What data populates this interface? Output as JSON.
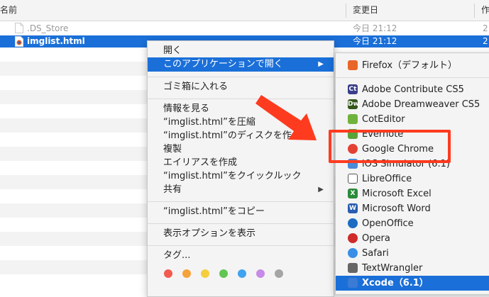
{
  "finder": {
    "columns": {
      "name": "名前",
      "date": "変更日",
      "kind": "作"
    },
    "files": [
      {
        "name": ".DS_Store",
        "date": "今日 21:12",
        "kind": "2",
        "state": "dim"
      },
      {
        "name": "imglist.html",
        "date": "今日 21:12",
        "kind": "2",
        "state": "selected"
      }
    ]
  },
  "context_menu": {
    "open": "開く",
    "open_with": "このアプリケーションで開く",
    "trash": "ゴミ箱に入れる",
    "get_info": "情報を見る",
    "compress": "“imglist.html”を圧縮",
    "burn": "“imglist.html”のディスクを作",
    "duplicate": "複製",
    "make_alias": "エイリアスを作成",
    "quick_look": "“imglist.html”をクイックルック",
    "share": "共有",
    "copy": "“imglist.html”をコピー",
    "view_options": "表示オプションを表示",
    "tags": "タグ...",
    "tag_colors": [
      "#f25b4f",
      "#f6a33b",
      "#f4cf3d",
      "#61c554",
      "#3fa3f0",
      "#c78ae8",
      "#a5a5a5"
    ]
  },
  "open_with_submenu": {
    "items": [
      {
        "label": "Firefox（デフォルト）",
        "icon": "firefox-icon",
        "color": "#e8662a"
      },
      {
        "label": "Adobe Contribute CS5",
        "icon": "contribute-icon",
        "color": "#3a3e8c",
        "glyph": "Ct"
      },
      {
        "label": "Adobe Dreamweaver CS5",
        "icon": "dreamweaver-icon",
        "color": "#35561a",
        "glyph": "Dw"
      },
      {
        "label": "CotEditor",
        "icon": "coteditor-icon",
        "color": "#6fb33c"
      },
      {
        "label": "Evernote",
        "icon": "evernote-icon",
        "color": "#59a43a"
      },
      {
        "label": "Google Chrome",
        "icon": "chrome-icon",
        "color": "#e34133"
      },
      {
        "label": "iOS Simulator (6.1)",
        "icon": "ios-simulator-icon",
        "color": "#4a8ad6"
      },
      {
        "label": "LibreOffice",
        "icon": "libreoffice-icon",
        "color": "#ffffff"
      },
      {
        "label": "Microsoft Excel",
        "icon": "excel-icon",
        "color": "#2c8a3b",
        "glyph": "X"
      },
      {
        "label": "Microsoft Word",
        "icon": "word-icon",
        "color": "#2a5db0",
        "glyph": "W"
      },
      {
        "label": "OpenOffice",
        "icon": "openoffice-icon",
        "color": "#1c6bc2"
      },
      {
        "label": "Opera",
        "icon": "opera-icon",
        "color": "#d02a2a"
      },
      {
        "label": "Safari",
        "icon": "safari-icon",
        "color": "#3a8ee6"
      },
      {
        "label": "TextWrangler",
        "icon": "textwrangler-icon",
        "color": "#666666"
      },
      {
        "label": "Xcode（6.1）",
        "icon": "xcode-icon",
        "color": "#3a7bd5"
      }
    ]
  },
  "annotation": {
    "highlight_color": "#ff3b1f"
  }
}
